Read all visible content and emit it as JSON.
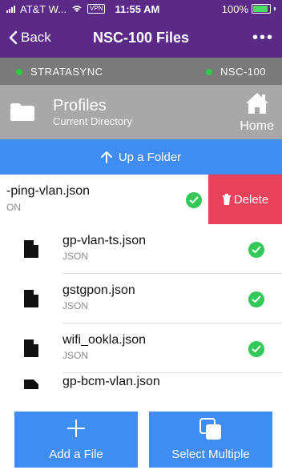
{
  "status": {
    "carrier": "AT&T W...",
    "vpn": "VPN",
    "time": "11:55 AM",
    "battery": "100%",
    "battery_level": 1.0
  },
  "nav": {
    "back_label": "Back",
    "title": "NSC-100 Files",
    "more": "•••"
  },
  "connections": [
    {
      "label": "STRATASYNC",
      "color": "#2ecc40"
    },
    {
      "label": "NSC-100",
      "color": "#2ecc40"
    }
  ],
  "directory": {
    "name": "Profiles",
    "subtitle": "Current Directory",
    "home_label": "Home"
  },
  "up_folder_label": "Up a Folder",
  "swiped_file": {
    "name": "-ping-vlan.json",
    "type": "ON",
    "delete_label": "Delete"
  },
  "files": [
    {
      "name": "gp-vlan-ts.json",
      "type": "JSON"
    },
    {
      "name": "gstgpon.json",
      "type": "JSON"
    },
    {
      "name": "wifi_ookla.json",
      "type": "JSON"
    }
  ],
  "partial_file": {
    "name": "gp-bcm-vlan.json"
  },
  "actions": {
    "add_label": "Add a File",
    "select_label": "Select Multiple"
  },
  "colors": {
    "nav": "#5b2a86",
    "accent": "#3f8cf3",
    "delete": "#e8435a",
    "success": "#34c759"
  }
}
